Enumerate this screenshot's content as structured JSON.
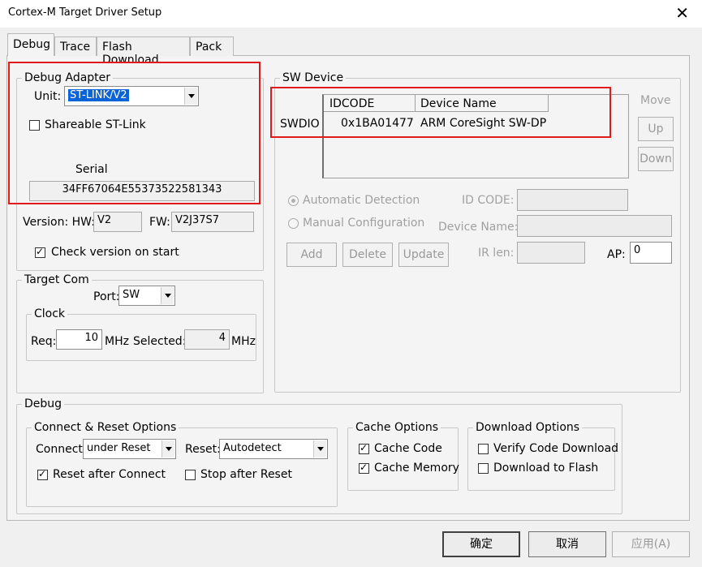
{
  "window": {
    "title": "Cortex-M Target Driver Setup",
    "close_glyph": "✕"
  },
  "tabs": [
    "Debug",
    "Trace",
    "Flash Download",
    "Pack"
  ],
  "debug_adapter": {
    "legend": "Debug Adapter",
    "unit_label": "Unit:",
    "unit_value": "ST-LINK/V2",
    "shareable_label": "Shareable ST-Link",
    "shareable_checked": false,
    "serial_label": "Serial",
    "serial_value": "34FF67064E55373522581343",
    "version_label": "Version: HW:",
    "hw_value": "V2",
    "fw_label": "FW:",
    "fw_value": "V2J37S7",
    "check_version_label": "Check version on start",
    "check_version_checked": true
  },
  "target_com": {
    "legend": "Target Com",
    "port_label": "Port:",
    "port_value": "SW",
    "clock_legend": "Clock",
    "req_label": "Req:",
    "req_value": "10",
    "req_unit": "MHz",
    "selected_label": "Selected:",
    "selected_value": "4",
    "selected_unit": "MHz"
  },
  "sw_device": {
    "legend": "SW Device",
    "row_label": "SWDIO",
    "col_idcode": "IDCODE",
    "col_device_name": "Device Name",
    "idcode": "0x1BA01477",
    "device_name": "ARM CoreSight SW-DP",
    "move_label": "Move",
    "up_button": "Up",
    "down_button": "Down",
    "auto_detect_label": "Automatic Detection",
    "manual_config_label": "Manual Configuration",
    "id_code_label": "ID CODE:",
    "device_name_label": "Device Name:",
    "ir_len_label": "IR len:",
    "ap_label": "AP:",
    "ap_value": "0",
    "add_button": "Add",
    "delete_button": "Delete",
    "update_button": "Update"
  },
  "debug": {
    "legend": "Debug",
    "connect_reset_legend": "Connect & Reset Options",
    "connect_label": "Connect:",
    "connect_value": "under Reset",
    "reset_label": "Reset:",
    "reset_value": "Autodetect",
    "reset_after_connect_label": "Reset after Connect",
    "reset_after_connect_checked": true,
    "stop_after_reset_label": "Stop after Reset",
    "stop_after_reset_checked": false,
    "cache_legend": "Cache Options",
    "cache_code_label": "Cache Code",
    "cache_memory_label": "Cache Memory",
    "download_legend": "Download Options",
    "verify_label": "Verify Code Download",
    "download_flash_label": "Download to Flash"
  },
  "footer": {
    "ok": "确定",
    "cancel": "取消",
    "apply": "应用(A)"
  },
  "colors": {
    "highlight": "#e11b1b",
    "selection": "#0a64d8"
  }
}
